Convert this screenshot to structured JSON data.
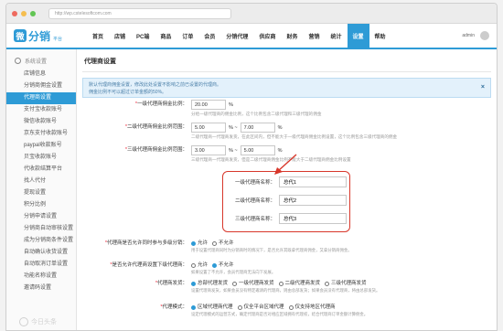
{
  "browser": {
    "address": "http://wp.cstelesoftcom.com"
  },
  "brand": {
    "logo_char": "微",
    "logo_text": "分销",
    "logo_sub": "平台"
  },
  "topnav": {
    "items": [
      "首页",
      "店铺",
      "PC端",
      "商品",
      "订单",
      "会员",
      "分销代理",
      "供应商",
      "财务",
      "营销",
      "统计",
      "设置",
      "帮助"
    ],
    "active_index": 11,
    "user": "admin"
  },
  "sidebar": {
    "heading": "系统设置",
    "items": [
      "店铺信息",
      "分销商佣金设置",
      "代理商设置",
      "支付宝收款账号",
      "微信收款账号",
      "京东支付收款账号",
      "paypal收款账号",
      "贝宝收款账号",
      "代收款结算平台",
      "找人代付",
      "提现设置",
      "积分比例",
      "分销申请设置",
      "分销商自动审核设置",
      "成为分销商条件设置",
      "自动确认收货设置",
      "自动取消订单设置",
      "功能名称设置",
      "邀请码设置"
    ],
    "active_index": 2
  },
  "main": {
    "title": "代理商设置",
    "notice_lines": [
      "默认代理商佣金设置，修改此处设置不影响之前已设置的代理商。",
      "佣金比例不可以超过订单金额的50%。"
    ],
    "notice_close": "×",
    "rate_rows": [
      {
        "label": "一级代理商佣金比例：",
        "value": "20.00",
        "unit": "%",
        "help": "分给一级代理商的佣金比例，这个比例包含二级代理和三级代理的佣金"
      },
      {
        "label": "二级代理商佣金比例范围：",
        "value": "5.00",
        "value2": "7.00",
        "unit": "%",
        "sep": "% ~",
        "help": "二级代理商一代理商发货，在此区间内，但不能大于一级代理商佣金比例设置，这个比例包含三级代理商的佣金"
      },
      {
        "label": "三级代理商佣金比例范围：",
        "value": "3.00",
        "value2": "5.00",
        "unit": "%",
        "sep": "% ~",
        "help": "三级代理商一代理商发货，但是二级代理商佣金比例不能大于二级代理商佣金比例设置"
      }
    ],
    "name_rows": [
      {
        "label": "一级代理商名称：",
        "value": "总代1"
      },
      {
        "label": "二级代理商名称：",
        "value": "总代2"
      },
      {
        "label": "三级代理商名称：",
        "value": "总代3"
      }
    ],
    "option_rows": [
      {
        "label": "代理商是否允许同时参与多级分销：",
        "options": [
          "允许",
          "不允许"
        ],
        "selected": 0,
        "help": "用于设置代理商同时为分销商时的情况下，是否允许其既拿代理商佣金，又拿分销商佣金。"
      },
      {
        "label": "是否允许代理商设置下级代理商：",
        "options": [
          "允许",
          "不允许"
        ],
        "selected": 1,
        "help": "如果设置了不允许，会员代理商无法向下发展。"
      },
      {
        "label": "代理商发货：",
        "options": [
          "总部代理发货",
          "一级代理商发货",
          "二级代理商发货",
          "三级代理商发货"
        ],
        "selected": 0,
        "help": "设置代理商发货，如果会员没有特定邀请的代理商，则由总部发货；如果会员没有代理商，将由总部发货。"
      },
      {
        "label": "代理模式：",
        "options": [
          "区域代理商代理",
          "仅全平台区域代理",
          "仅支持地区代理商"
        ],
        "selected": 0,
        "help": "设定代理模式的运营方式，确定代理商是否对相应区域拥有代理权，结合代理商订单金额计算佣金。"
      }
    ]
  },
  "watermark": "今日头条"
}
